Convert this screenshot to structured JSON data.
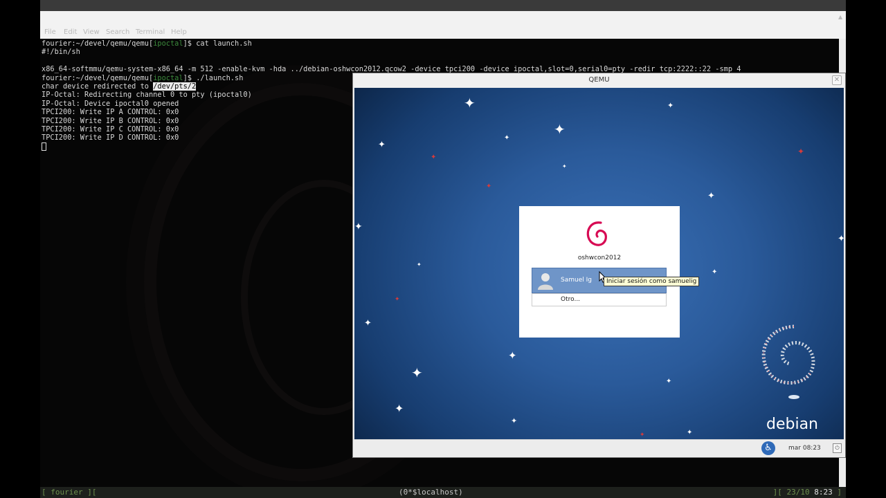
{
  "terminal": {
    "menu": [
      "File",
      "Edit",
      "View",
      "Search",
      "Terminal",
      "Help"
    ],
    "lines": [
      {
        "prompt_pre": "fourier:~/devel/qemu/qemu[",
        "branch": "ipoctal",
        "prompt_post": "]$ ",
        "text": "cat launch.sh"
      },
      {
        "text": "#!/bin/sh"
      },
      {
        "text": ""
      },
      {
        "text": "x86_64-softmmu/qemu-system-x86_64 -m 512 -enable-kvm -hda ../debian-oshwcon2012.qcow2 -device tpci200 -device ipoctal,slot=0,serial0=pty -redir tcp:2222::22 -smp 4"
      },
      {
        "prompt_pre": "fourier:~/devel/qemu/qemu[",
        "branch": "ipoctal",
        "prompt_post": "]$ ",
        "text": "./launch.sh"
      },
      {
        "text": "char device redirected to ",
        "highlight": "/dev/pts/2"
      },
      {
        "text": "IP-Octal: Redirecting channel 0 to pty (ipoctal0)"
      },
      {
        "text": "IP-Octal: Device ipoctal0 opened"
      },
      {
        "text": "TPCI200: Write IP A CONTROL: 0x0"
      },
      {
        "text": "TPCI200: Write IP B CONTROL: 0x0"
      },
      {
        "text": "TPCI200: Write IP C CONTROL: 0x0"
      },
      {
        "text": "TPCI200: Write IP D CONTROL: 0x0"
      }
    ]
  },
  "qemu": {
    "title": "QEMU",
    "login": {
      "hostname": "oshwcon2012",
      "user_name": "Samuel Ig",
      "tooltip": "Iniciar sesión como samuelig",
      "other": "Otro..."
    },
    "debian_label": "debian",
    "panel_clock": "mar 08:23",
    "colors": {
      "login_selected": "#6f95c8",
      "debian_red": "#d70a53",
      "background_blue": "#2a5a9a"
    }
  },
  "statusbar": {
    "left": "[ fourier ][",
    "middle": "(0*$localhost)",
    "right_date": "][ 23/10 ",
    "right_time": "8:23",
    "right_end": " ]"
  }
}
